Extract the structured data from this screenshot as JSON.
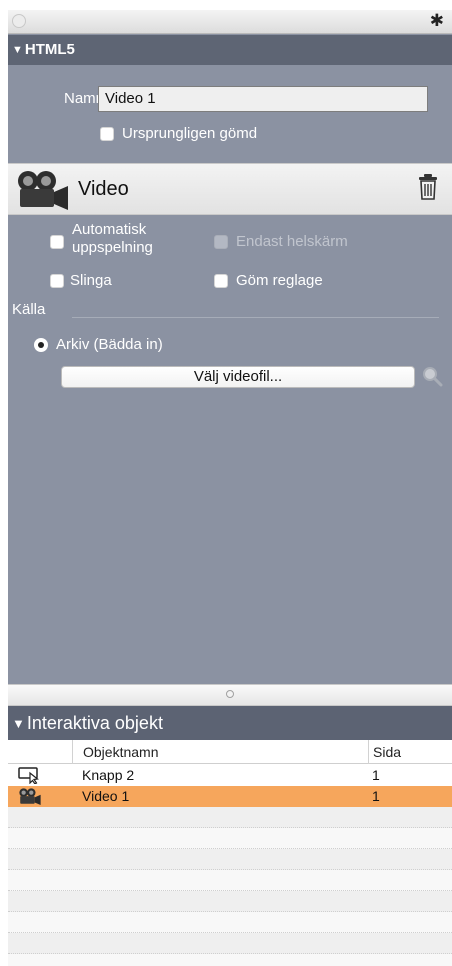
{
  "html5_section": {
    "title": "HTML5",
    "name_label": "Namn:",
    "name_value": "Video 1",
    "initially_hidden_label": "Ursprungligen gömd"
  },
  "video_section": {
    "title": "Video",
    "autoplay_label_line1": "Automatisk",
    "autoplay_label_line2": "uppspelning",
    "fullscreen_only_label": "Endast helskärm",
    "loop_label": "Slinga",
    "hide_controls_label": "Göm reglage",
    "source_label": "Källa",
    "archive_radio_label": "Arkiv (Bädda in)",
    "choose_file_button": "Välj videofil..."
  },
  "interactive_objects": {
    "title": "Interaktiva objekt",
    "columns": [
      "Objektnamn",
      "Sida"
    ],
    "rows": [
      {
        "icon": "button-icon",
        "name": "Knapp 2",
        "page": "1",
        "selected": false
      },
      {
        "icon": "video-camera-icon",
        "name": "Video 1",
        "page": "1",
        "selected": true
      }
    ]
  },
  "colors": {
    "panel_bg": "#8b92a2",
    "header_bg": "#5e6574",
    "selected_row": "#f6a65c"
  }
}
